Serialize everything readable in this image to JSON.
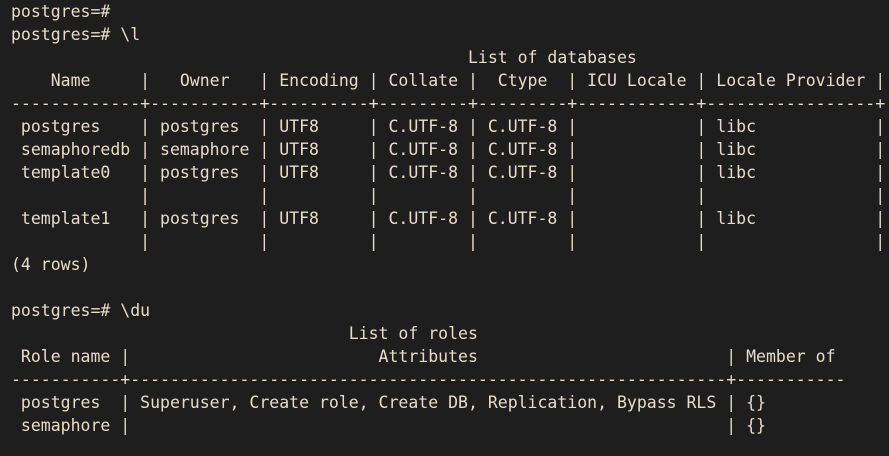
{
  "terminal": {
    "lines": [
      "postgres=#",
      "postgres=# \\l",
      "                                              List of databases",
      "    Name     |   Owner   | Encoding | Collate |  Ctype  | ICU Locale | Locale Provider |",
      "-------------+-----------+----------+---------+---------+------------+-----------------+",
      " postgres    | postgres  | UTF8     | C.UTF-8 | C.UTF-8 |            | libc            |",
      " semaphoredb | semaphore | UTF8     | C.UTF-8 | C.UTF-8 |            | libc            |",
      " template0   | postgres  | UTF8     | C.UTF-8 | C.UTF-8 |            | libc            |",
      "             |           |          |         |         |            |                 |",
      " template1   | postgres  | UTF8     | C.UTF-8 | C.UTF-8 |            | libc            |",
      "             |           |          |         |         |            |                 |",
      "(4 rows)",
      "",
      "postgres=# \\du",
      "                                  List of roles",
      " Role name |                         Attributes                         | Member of",
      "-----------+------------------------------------------------------------+-----------",
      " postgres  | Superuser, Create role, Create DB, Replication, Bypass RLS | {}",
      " semaphore |                                                            | {}"
    ]
  },
  "colors": {
    "background": "#1e1e1e",
    "foreground": "#e8dcc8"
  }
}
